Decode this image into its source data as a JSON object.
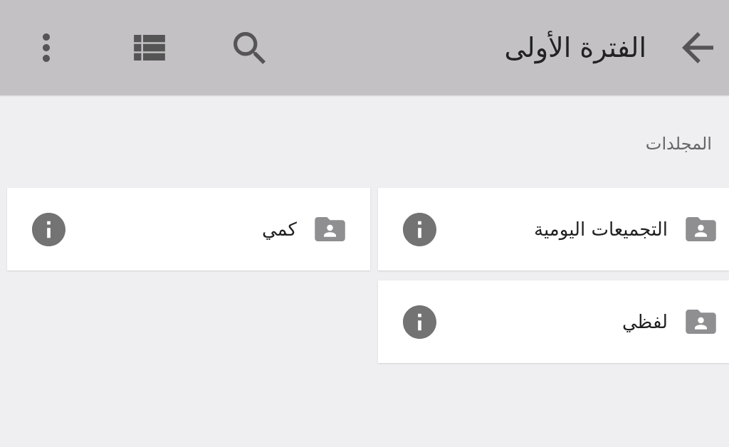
{
  "app_bar": {
    "title": "الفترة الأولى"
  },
  "section": {
    "title": "المجلدات"
  },
  "folders": [
    {
      "name": "التجميعات اليومية"
    },
    {
      "name": "كمي"
    },
    {
      "name": "لفظي"
    }
  ]
}
